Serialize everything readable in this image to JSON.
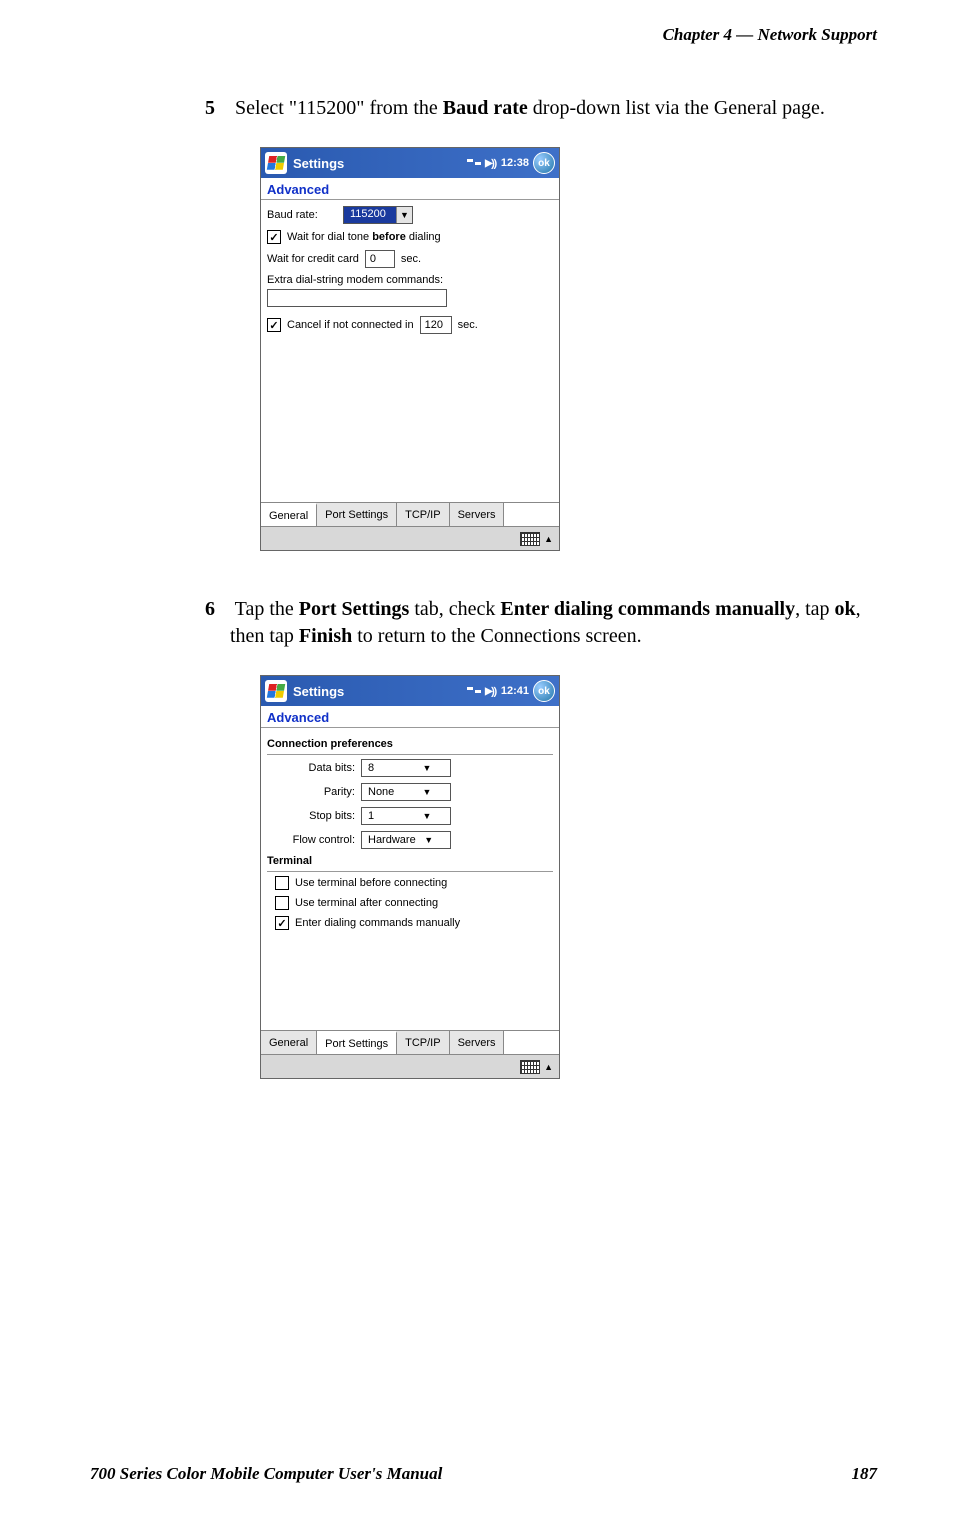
{
  "header": {
    "chapter_label": "Chapter  4  —  Network Support"
  },
  "footer": {
    "manual_title": "700 Series Color Mobile Computer User's Manual",
    "page_number": "187"
  },
  "step5": {
    "number": "5",
    "text_before_quote": "Select \"",
    "baud_value": "115200",
    "text_mid1": "\" from the ",
    "bold1": "Baud rate",
    "text_after": " drop-down list via the General page."
  },
  "step6": {
    "number": "6",
    "t1": "Tap the ",
    "b1": "Port Settings",
    "t2": " tab, check ",
    "b2": "Enter dialing commands manually",
    "t3": ", tap ",
    "b3": "ok",
    "t4": ", then tap ",
    "b4": "Finish",
    "t5": " to return to the Connections screen."
  },
  "screen1": {
    "title": "Settings",
    "time": "12:38",
    "ok": "ok",
    "subtitle": "Advanced",
    "baud_label": "Baud rate:",
    "baud_value": "115200",
    "wait_dial_before": "Wait for dial tone ",
    "wait_dial_bold": "before",
    "wait_dial_after": " dialing",
    "wait_dial_checked": true,
    "wait_credit": "Wait for credit card",
    "wait_credit_val": "0",
    "sec": "sec.",
    "extra_cmds": "Extra dial-string modem commands:",
    "cancel_label": "Cancel if not connected in",
    "cancel_val": "120",
    "cancel_checked": true,
    "tabs": [
      "General",
      "Port Settings",
      "TCP/IP",
      "Servers"
    ],
    "active_tab": 0
  },
  "screen2": {
    "title": "Settings",
    "time": "12:41",
    "ok": "ok",
    "subtitle": "Advanced",
    "sect_conn": "Connection preferences",
    "data_bits_label": "Data bits:",
    "data_bits_val": "8",
    "parity_label": "Parity:",
    "parity_val": "None",
    "stop_bits_label": "Stop bits:",
    "stop_bits_val": "1",
    "flow_label": "Flow control:",
    "flow_val": "Hardware",
    "sect_term": "Terminal",
    "term_before": "Use terminal before connecting",
    "term_before_checked": false,
    "term_after": "Use terminal after connecting",
    "term_after_checked": false,
    "term_manual": "Enter dialing commands manually",
    "term_manual_checked": true,
    "tabs": [
      "General",
      "Port Settings",
      "TCP/IP",
      "Servers"
    ],
    "active_tab": 1
  }
}
